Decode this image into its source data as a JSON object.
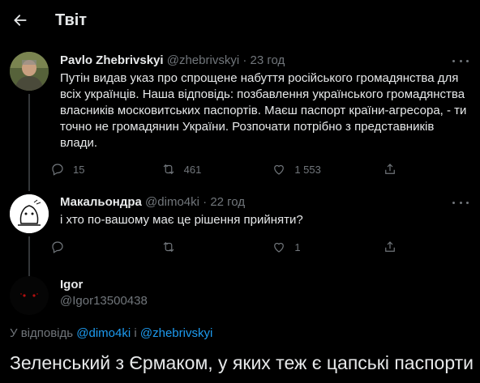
{
  "header": {
    "title": "Твіт"
  },
  "tweets": [
    {
      "name": "Pavlo Zhebrivskyi",
      "handle": "@zhebrivskyi",
      "dot": "·",
      "time": "23 год",
      "lines": [
        "Путін видав указ про спрощене набуття російського громадянства для",
        "всіх українців. Наша відповідь: позбавлення українського громадянства",
        "власників московитських паспортів. Маєш паспорт країни-агресора, - ти",
        "точно не громадянин України. Розпочати потрібно з представників",
        "влади."
      ],
      "replies": "15",
      "retweets": "461",
      "likes": "1 553"
    },
    {
      "name": "Макальондра",
      "handle": "@dimo4ki",
      "dot": "·",
      "time": "22 год",
      "lines": [
        "і хто  по-вашому має це рішення прийняти?"
      ],
      "replies": "",
      "retweets": "",
      "likes": "1"
    }
  ],
  "focus": {
    "name": "Igor",
    "handle": "@Igor13500438",
    "replying_prefix": "У відповідь",
    "mention1": "@dimo4ki",
    "joiner": "і",
    "mention2": "@zhebrivskyi",
    "text": "Зеленський з Єрмаком, у яких теж є цапські паспорти"
  },
  "colors": {
    "background": "#000000",
    "text": "#e7e9ea",
    "secondary": "#71767b",
    "accent": "#1d9bf0",
    "line": "#333639"
  }
}
